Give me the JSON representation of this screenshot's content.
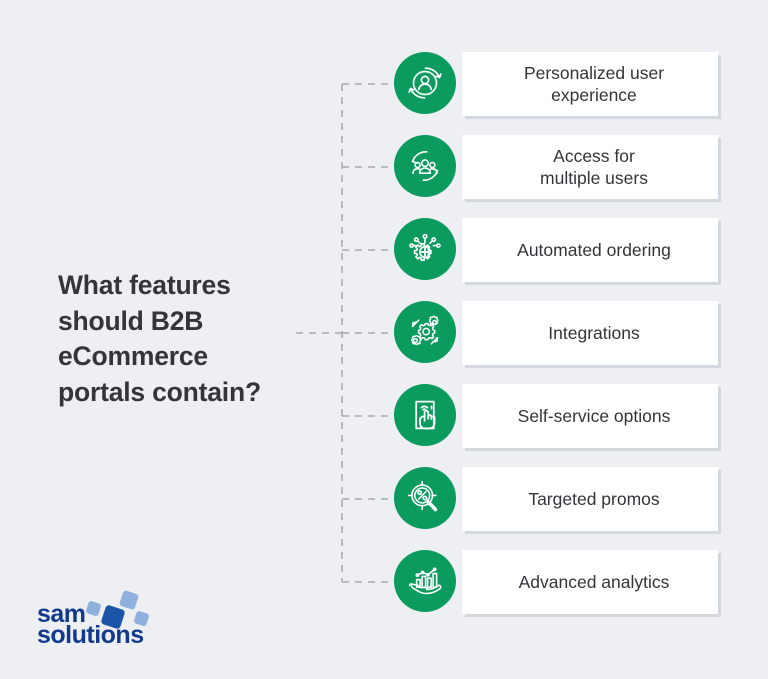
{
  "theme": {
    "background": "#edeff3",
    "accent_green": "#0c9b5e",
    "card_background": "#ffffff",
    "text_color": "#34353a",
    "connector_color": "#a8acb4",
    "logo_dark_blue": "#123a8c",
    "logo_light_blue": "#8fb0dd"
  },
  "title": {
    "line1": "What features",
    "line2": "should B2B",
    "line3": "eCommerce",
    "line4": "portals contain?",
    "full": "What features should B2B eCommerce portals contain?"
  },
  "features": [
    {
      "label": "Personalized user experience",
      "label_line1": "Personalized user",
      "label_line2": "experience",
      "icon": "user-refresh-icon"
    },
    {
      "label": "Access for multiple users",
      "label_line1": "Access for",
      "label_line2": "multiple users",
      "icon": "user-group-refresh-icon"
    },
    {
      "label": "Automated ordering",
      "label_line1": "Automated ordering",
      "label_line2": "",
      "icon": "gear-circuit-plus-icon"
    },
    {
      "label": "Integrations",
      "label_line1": "Integrations",
      "label_line2": "",
      "icon": "multiple-gears-icon"
    },
    {
      "label": "Self-service options",
      "label_line1": "Self-service options",
      "label_line2": "",
      "icon": "hand-tap-phone-icon"
    },
    {
      "label": "Targeted promos",
      "label_line1": "Targeted promos",
      "label_line2": "",
      "icon": "magnifier-percent-target-icon"
    },
    {
      "label": "Advanced analytics",
      "label_line1": "Advanced analytics",
      "label_line2": "",
      "icon": "hand-bar-chart-icon"
    }
  ],
  "logo": {
    "line1": "sam",
    "line2": "solutions",
    "alt": "sam solutions logo"
  }
}
